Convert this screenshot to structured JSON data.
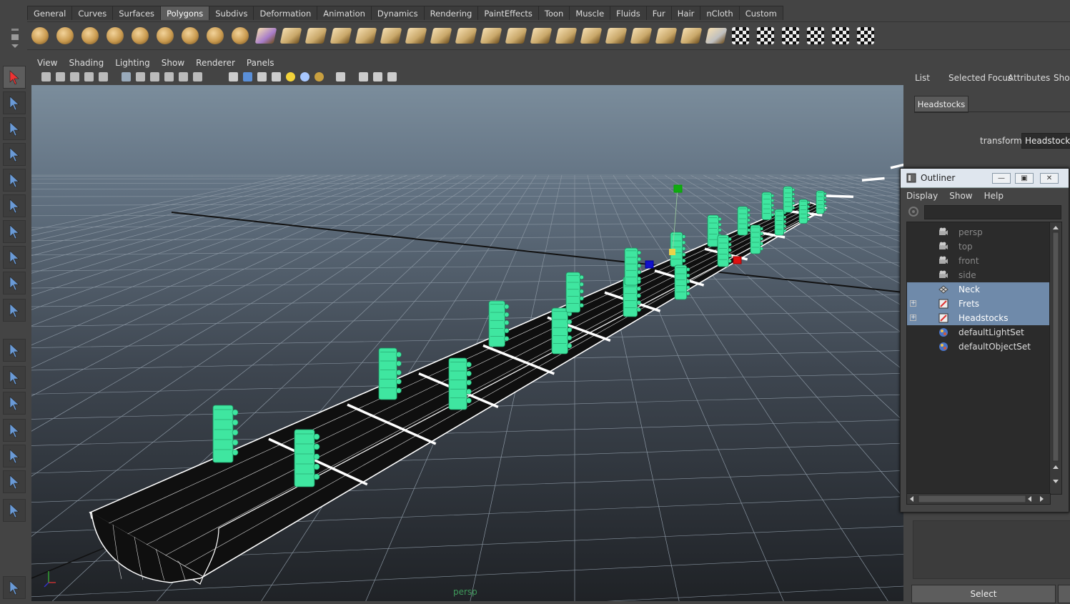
{
  "shelf": {
    "tabs": [
      "General",
      "Curves",
      "Surfaces",
      "Polygons",
      "Subdivs",
      "Deformation",
      "Animation",
      "Dynamics",
      "Rendering",
      "PaintEffects",
      "Toon",
      "Muscle",
      "Fluids",
      "Fur",
      "Hair",
      "nCloth",
      "Custom"
    ],
    "active_tab": "Polygons"
  },
  "panel": {
    "menus": [
      "View",
      "Shading",
      "Lighting",
      "Show",
      "Renderer",
      "Panels"
    ],
    "camera_label": "persp"
  },
  "attribute_editor": {
    "menus": [
      "List",
      "Selected",
      "Focus",
      "Attributes",
      "Show"
    ],
    "tab": "Headstocks",
    "transform_label": "transform:",
    "transform_value": "Headstocks",
    "select_button": "Select"
  },
  "outliner": {
    "title": "Outliner",
    "menus": [
      "Display",
      "Show",
      "Help"
    ],
    "items": [
      {
        "label": "persp",
        "type": "camera",
        "selected": false,
        "dim": true,
        "expandable": false
      },
      {
        "label": "top",
        "type": "camera",
        "selected": false,
        "dim": true,
        "expandable": false
      },
      {
        "label": "front",
        "type": "camera",
        "selected": false,
        "dim": true,
        "expandable": false
      },
      {
        "label": "side",
        "type": "camera",
        "selected": false,
        "dim": true,
        "expandable": false
      },
      {
        "label": "Neck",
        "type": "mesh",
        "selected": true,
        "dim": false,
        "expandable": false
      },
      {
        "label": "Frets",
        "type": "group",
        "selected": true,
        "dim": false,
        "expandable": true
      },
      {
        "label": "Headstocks",
        "type": "group",
        "selected": true,
        "dim": false,
        "expandable": true
      },
      {
        "label": "defaultLightSet",
        "type": "set",
        "selected": false,
        "dim": false,
        "expandable": false
      },
      {
        "label": "defaultObjectSet",
        "type": "set",
        "selected": false,
        "dim": false,
        "expandable": false
      }
    ]
  },
  "colors": {
    "selection_green": "#3fe6a0",
    "outliner_select": "#6f8aaa",
    "manip_x": "#d11",
    "manip_y": "#1a1",
    "manip_z": "#11c"
  }
}
